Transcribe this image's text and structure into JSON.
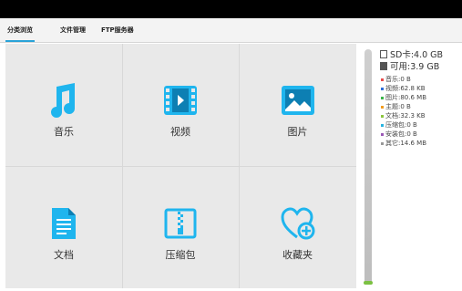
{
  "tabs": [
    {
      "label": "分类浏览",
      "active": true
    },
    {
      "label": "文件管理",
      "active": false
    },
    {
      "label": "FTP服务器",
      "active": false
    }
  ],
  "categories": [
    {
      "label": "音乐",
      "icon": "music-note-icon"
    },
    {
      "label": "视频",
      "icon": "film-icon"
    },
    {
      "label": "图片",
      "icon": "image-icon"
    },
    {
      "label": "文档",
      "icon": "document-icon"
    },
    {
      "label": "压缩包",
      "icon": "zip-icon"
    },
    {
      "label": "收藏夹",
      "icon": "heart-add-icon"
    }
  ],
  "storage": {
    "sd_card": "SD卡:4.0 GB",
    "available": "可用:3.9 GB",
    "items": [
      {
        "label": "音乐:0 B",
        "color": "#e94b4b"
      },
      {
        "label": "视频:62.8 KB",
        "color": "#2e6fd9"
      },
      {
        "label": "图片:80.6 MB",
        "color": "#3bb54a"
      },
      {
        "label": "主题:0 B",
        "color": "#f29c1f"
      },
      {
        "label": "文档:32.3 KB",
        "color": "#8cc63f"
      },
      {
        "label": "压缩包:0 B",
        "color": "#27b3e0"
      },
      {
        "label": "安装包:0 B",
        "color": "#9b59b6"
      },
      {
        "label": "其它:14.6 MB",
        "color": "#999999"
      }
    ]
  },
  "colors": {
    "accent": "#2aa3d8",
    "icon": "#1fb5ee"
  }
}
